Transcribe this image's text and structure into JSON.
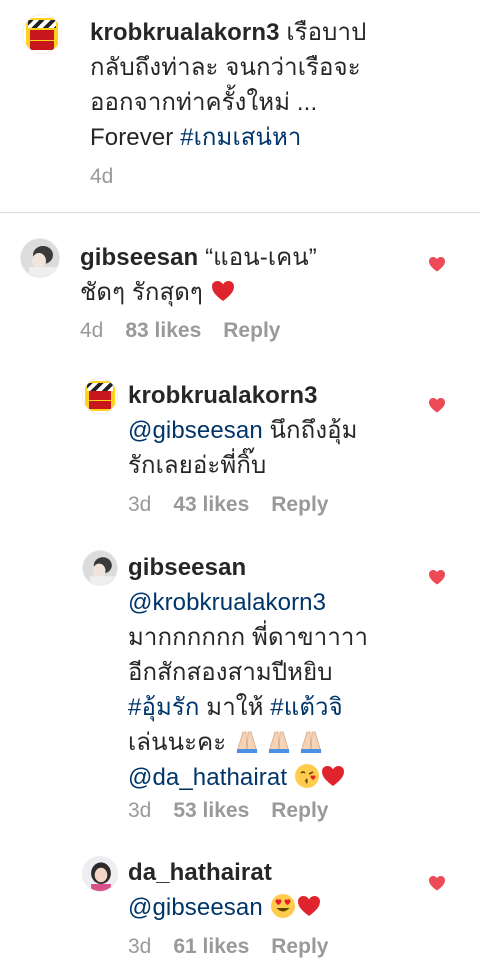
{
  "caption": {
    "username": "krobkrualakorn3",
    "text_line1": " เรือบาป",
    "text_line2": "กลับถึงท่าละ จนกว่าเรือจะ",
    "text_line3": "ออกจากท่าครั้งใหม่ ...",
    "text_line4_prefix": "Forever ",
    "hashtag": "#เกมเสน่หา",
    "time": "4d"
  },
  "comments": [
    {
      "username": "gibseesan",
      "line1": " “แอน-เคน”",
      "line2": "ชัดๆ รักสุดๆ ",
      "time": "4d",
      "likes": "83 likes",
      "reply": "Reply"
    },
    {
      "username": "krobkrualakorn3",
      "mention": "@gibseesan",
      "line1_rest": " นึกถึงอุ้ม",
      "line2": "รักเลยอ่ะพี่กิ๊บ",
      "time": "3d",
      "likes": "43 likes",
      "reply": "Reply"
    },
    {
      "username": "gibseesan",
      "mention": "@krobkrualakorn3",
      "line2": "มากกกกกก พี่ดาขาาาา",
      "line3": "อีกสักสองสามปีหยิบ",
      "hashtag1": "#อุ้มรัก",
      "line4_mid": " มาให้ ",
      "hashtag2": "#แต้วจิ",
      "line5": "เล่นนะคะ ",
      "mention2": "@da_hathairat",
      "time": "3d",
      "likes": "53 likes",
      "reply": "Reply"
    },
    {
      "username": "da_hathairat",
      "mention": "@gibseesan",
      "time": "3d",
      "likes": "61 likes",
      "reply": "Reply"
    }
  ],
  "colors": {
    "text": "#262626",
    "link": "#003569",
    "meta": "#999999",
    "heart": "#ed4956",
    "divider": "#dbdbdb"
  },
  "icons": [
    "heart-icon",
    "pray-emoji",
    "kiss-emoji",
    "heart-eyes-emoji"
  ]
}
